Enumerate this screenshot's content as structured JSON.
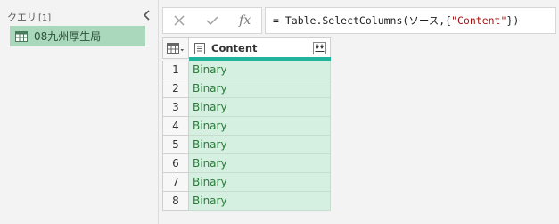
{
  "queries_pane": {
    "title": "クエリ",
    "count": "[1]",
    "items": [
      {
        "label": "08九州厚生局",
        "selected": true
      }
    ]
  },
  "formula_bar": {
    "cancel_icon": "close-icon",
    "commit_icon": "check-icon",
    "fx_label": "fx",
    "formula_prefix": "= Table.SelectColumns(ソース,{",
    "formula_string": "\"Content\"",
    "formula_suffix": "})"
  },
  "grid": {
    "columns": [
      {
        "name": "Content",
        "type_icon": "document-icon",
        "expand_icon": "expand-icon"
      }
    ],
    "rows": [
      {
        "index": "1",
        "content": "Binary"
      },
      {
        "index": "2",
        "content": "Binary"
      },
      {
        "index": "3",
        "content": "Binary"
      },
      {
        "index": "4",
        "content": "Binary"
      },
      {
        "index": "5",
        "content": "Binary"
      },
      {
        "index": "6",
        "content": "Binary"
      },
      {
        "index": "7",
        "content": "Binary"
      },
      {
        "index": "8",
        "content": "Binary"
      }
    ]
  },
  "colors": {
    "selected_query": "#a9d8bd",
    "quality_bar": "#21b39b",
    "binary_cell_bg": "#d5f0e1",
    "binary_text": "#2a7a3a"
  }
}
